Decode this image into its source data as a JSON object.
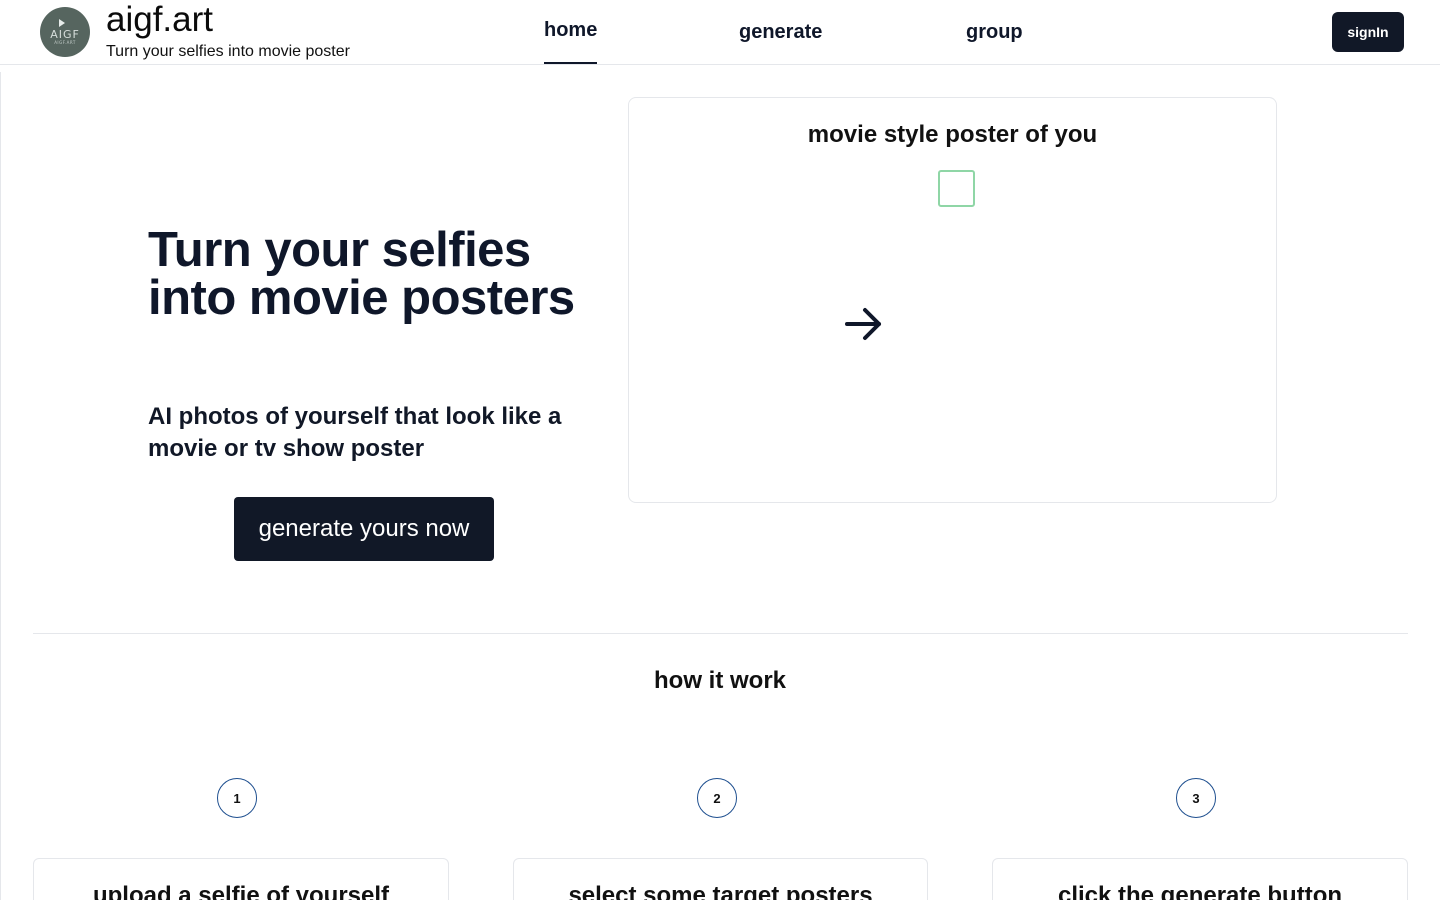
{
  "header": {
    "logo": {
      "text": "AIGF",
      "sub": "AIGF.ART"
    },
    "brand_name": "aigf.art",
    "tagline": "Turn your selfies into movie poster",
    "nav": [
      {
        "label": "home",
        "active": true
      },
      {
        "label": "generate",
        "active": false
      },
      {
        "label": "group",
        "active": false
      }
    ],
    "signin_label": "signIn"
  },
  "hero": {
    "title": "Turn your selfies into movie posters",
    "subtitle": "AI photos of yourself that look like a movie or tv show poster",
    "cta_label": "generate yours now"
  },
  "poster_card": {
    "title": "movie style poster of you",
    "arrow_icon": "arrow-right-icon"
  },
  "how_it_works": {
    "title": "how it work",
    "steps": [
      {
        "number": "1",
        "text": "upload a selfie of yourself"
      },
      {
        "number": "2",
        "text": "select some target posters"
      },
      {
        "number": "3",
        "text": "click the generate button"
      }
    ]
  },
  "colors": {
    "primary_dark": "#111827",
    "border": "#e5e7eb",
    "step_ring": "#1e4f8f",
    "thumb_border": "#8fd6a6"
  }
}
